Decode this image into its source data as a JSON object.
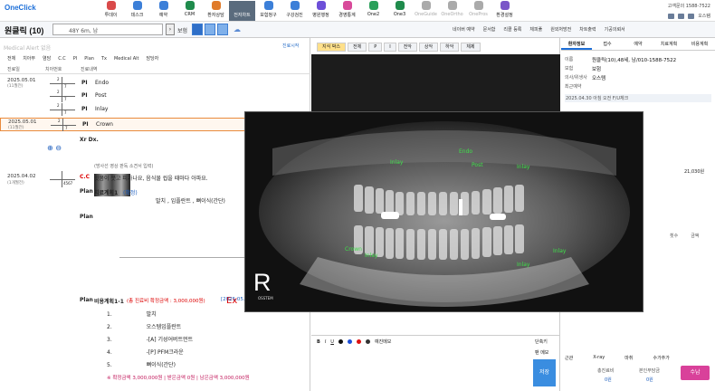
{
  "app": {
    "logo": "OneClick",
    "phone": "고객문의 1588-7522",
    "user": "오스템"
  },
  "toolbar": [
    "투데이",
    "데스크",
    "예약",
    "CRM",
    "환자상담",
    "전자차트",
    "보험청구",
    "구강검진",
    "병원행정",
    "경영통계",
    "One2",
    "One3",
    "OneGuide",
    "OneOrtho",
    "OnePros",
    "환경설정"
  ],
  "patient": {
    "name": "원클릭 (10)",
    "info": "48Y 6m, 남",
    "insurance": "보험"
  },
  "topmenus": [
    "네이버 예약",
    "문서함",
    "리콜 등록",
    "체피풀",
    "원외처방전",
    "차트출력",
    "기공의뢰서"
  ],
  "left": {
    "alert": "Medical Alert 없음",
    "chart_start": "진료시작",
    "tabs": [
      "전체",
      "치아부",
      "염담",
      "C.C",
      "PI",
      "Plan",
      "Tx",
      "Medical Alt",
      "담당자"
    ],
    "cols": [
      "진료일",
      "치아번호",
      "진료내역"
    ],
    "rows": [
      {
        "date": "2025.05.01",
        "sub": "(11월전)",
        "pi": "PI",
        "proc": "Endo",
        "t1": "2",
        "t2": "7"
      },
      {
        "date": "",
        "sub": "",
        "pi": "PI",
        "proc": "Post",
        "t1": "2",
        "t2": "7"
      },
      {
        "date": "",
        "sub": "",
        "pi": "PI",
        "proc": "Inlay",
        "t1": "2",
        "t2": "7"
      },
      {
        "date": "2025.05.01",
        "sub": "(11월전)",
        "pi": "PI",
        "proc": "Crown",
        "t1": "2",
        "t2": "7"
      }
    ],
    "xrdx": "Xr Dx.",
    "xcaption": "(방사선 영상 판독 소견서 입력)",
    "row2_date": "2025.04.02",
    "row2_sub": "(1개월전)",
    "row2_tooth": "4567",
    "cc_label": "C.C",
    "cc_text": "잇몸이 붓고 피가나요, 음식물 씹을 때마다 아파요.",
    "plan_label": "Plan",
    "plan_title": "치료계획1",
    "plan_tag": "(확정)",
    "plan_items": "발치 , 임플란트 , 뼈이식(간단)",
    "plan2_title": "비용계획1-1",
    "plan2_sum": "(총 진료비 확정금액 : 3,000,000원)",
    "plan2_date": "[2025.05.1",
    "plan2_list": [
      "발치",
      "오스템임플란트",
      "-[A] 기성어버트먼트",
      "-[P] PFM크라운",
      "뼈이식(간단)"
    ],
    "plan2_total": "※ 확정금액 3,000,000원 | 받은금액 0원 | 남은금액 3,000,000원",
    "ex_label": "Ex"
  },
  "center": {
    "xtoolbar": [
      "지식 박스",
      "전체",
      "P",
      "I",
      "전악",
      "상악",
      "하악",
      "체제"
    ],
    "editor_label": "예진메모",
    "short": "단축키",
    "memo": "팬 메모",
    "save": "저장"
  },
  "right": {
    "tabs": [
      "환자정보",
      "접수",
      "예약",
      "치료계획",
      "비용계획"
    ],
    "name_label": "이름",
    "name_val": "원클릭(10),48세, 남/010-1588-7522",
    "ins_label": "보험",
    "ins_val": "보험",
    "doc_label": "의사/위생사",
    "doc_val": "오스템",
    "recent_label": "최근예약",
    "recent_val": "2025.04.30  아침  오전 F/U체크",
    "amount": "21,030원",
    "cols": [
      "횟수",
      "금액"
    ],
    "bottom": [
      "근관",
      "X-ray",
      "마취",
      "수가추가"
    ],
    "fee1_label": "총진료비",
    "fee1": "0원",
    "fee2_label": "본인부담금",
    "fee2": "0원",
    "pay": "수납"
  },
  "xray": {
    "mark": "R",
    "sub": "OSSTEM",
    "labels": [
      "Endo",
      "Inlay",
      "Post",
      "Inlay",
      "Crown",
      "Inlay",
      "Inlay",
      "Inlay"
    ]
  }
}
